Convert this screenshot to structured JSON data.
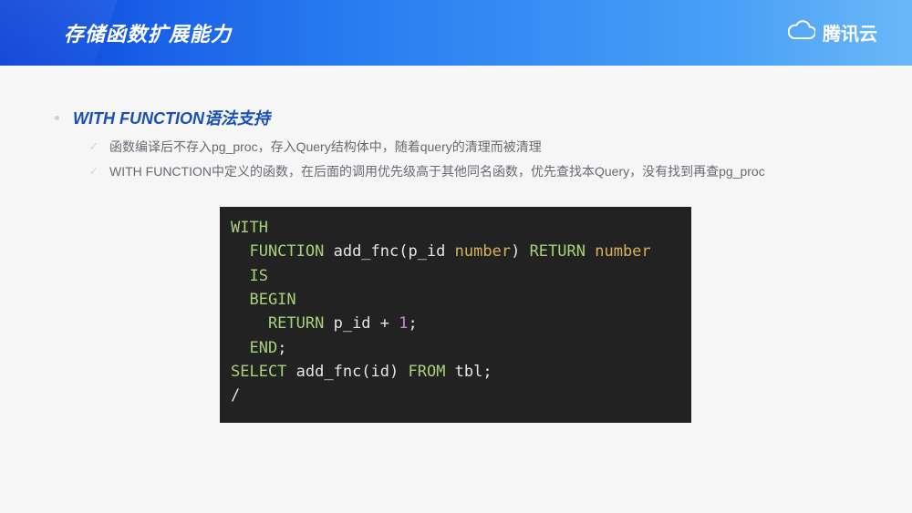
{
  "header": {
    "title": "存储函数扩展能力",
    "brand": "腾讯云"
  },
  "section": {
    "heading": "WITH FUNCTION语法支持",
    "bullets": [
      "函数编译后不存入pg_proc，存入Query结构体中，随着query的清理而被清理",
      "WITH FUNCTION中定义的函数，在后面的调用优先级高于其他同名函数，优先查找本Query，没有找到再查pg_proc"
    ]
  },
  "code": {
    "l1_with": "WITH",
    "l2_fn": "FUNCTION",
    "l2_name": " add_fnc(p_id ",
    "l2_ty1": "number",
    "l2_ret": ") ",
    "l2_retkw": "RETURN",
    "l2_sp": " ",
    "l2_ty2": "number",
    "l3_is": "IS",
    "l4_begin": "BEGIN",
    "l5_retkw": "RETURN",
    "l5_expr": " p_id + ",
    "l5_num": "1",
    "l5_semi": ";",
    "l6_end": "END",
    "l6_semi": ";",
    "l7_select": "SELECT",
    "l7_call": " add_fnc(id) ",
    "l7_from": "FROM",
    "l7_tbl": " tbl;",
    "l8_slash": "/"
  }
}
